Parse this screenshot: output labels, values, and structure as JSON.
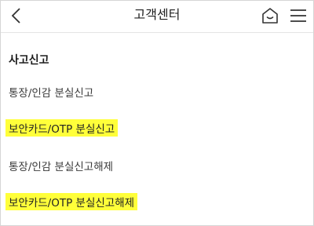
{
  "header": {
    "title": "고객센터",
    "back_icon": "chevron-left-icon",
    "home_icon": "home-icon",
    "menu_icon": "hamburger-menu-icon"
  },
  "section": {
    "title": "사고신고",
    "items": [
      {
        "label": "통장/인감 분실신고",
        "highlighted": false
      },
      {
        "label": "보안카드/OTP 분실신고",
        "highlighted": true
      },
      {
        "label": "통장/인감 분실신고해제",
        "highlighted": false
      },
      {
        "label": "보안카드/OTP 분실신고해제",
        "highlighted": true
      }
    ]
  },
  "colors": {
    "highlight": "#ffff3a",
    "divider": "#e4e4e4"
  }
}
